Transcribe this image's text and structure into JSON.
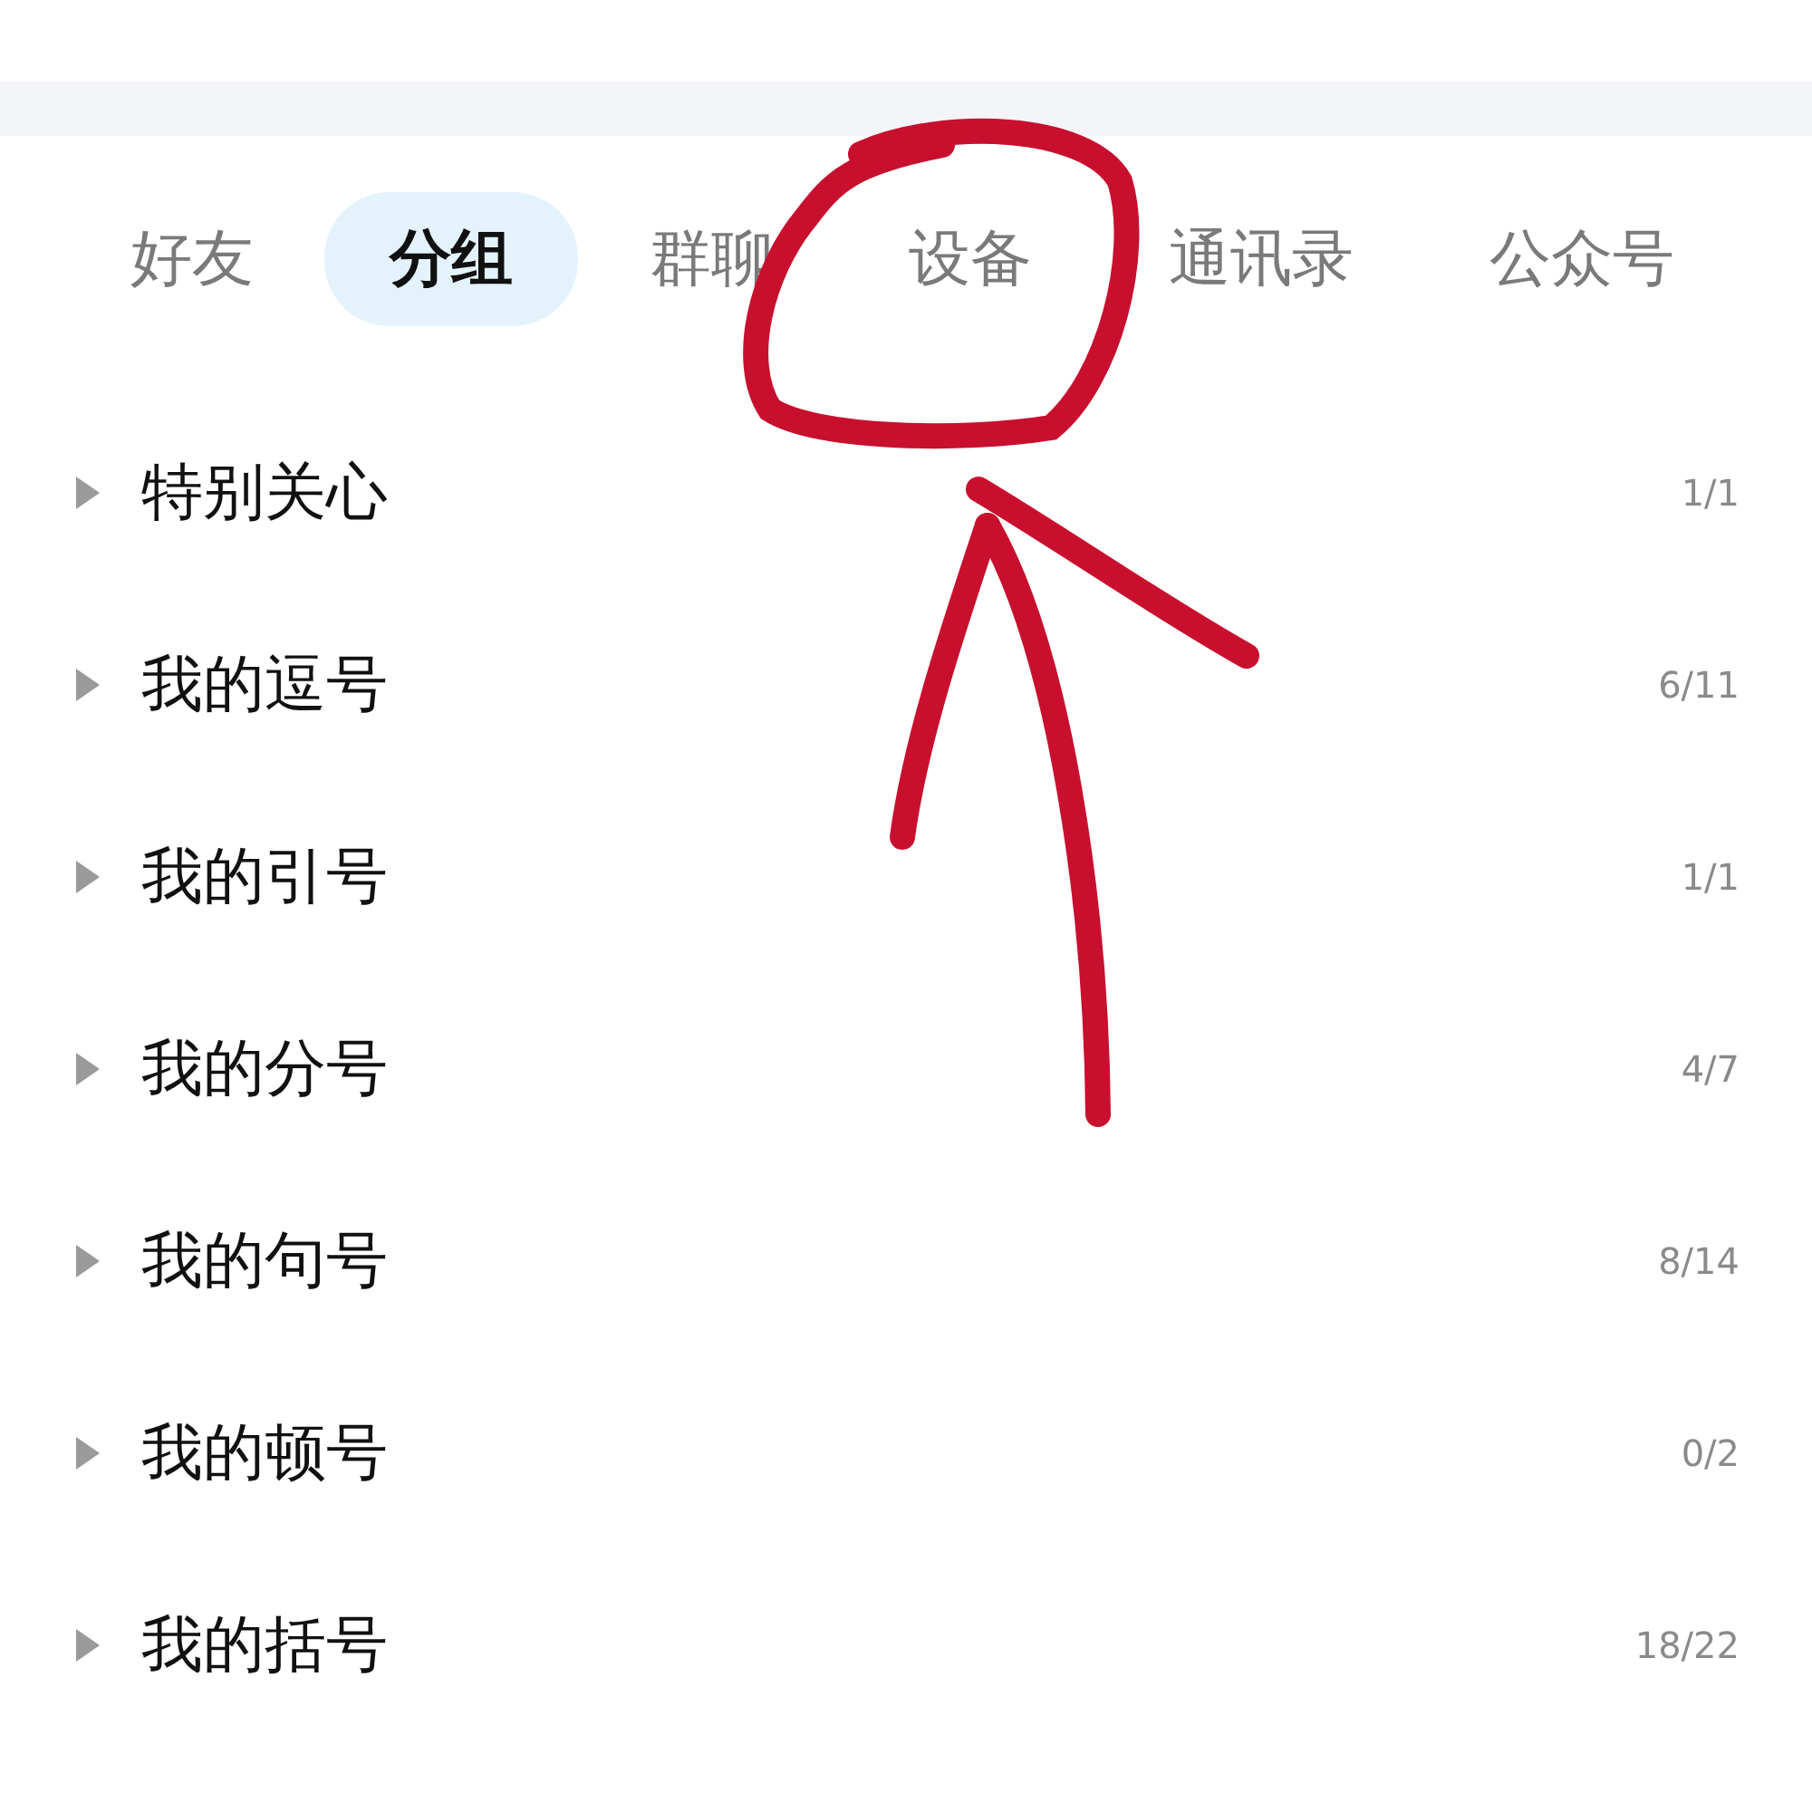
{
  "tabs": [
    {
      "label": "好友",
      "selected": false
    },
    {
      "label": "分组",
      "selected": true
    },
    {
      "label": "群聊",
      "selected": false
    },
    {
      "label": "设备",
      "selected": false
    },
    {
      "label": "通讯录",
      "selected": false
    },
    {
      "label": "公众号",
      "selected": false
    }
  ],
  "groups": [
    {
      "name": "特别关心",
      "count": "1/1",
      "expanded": false
    },
    {
      "name": "我的逗号",
      "count": "6/11",
      "expanded": false
    },
    {
      "name": "我的引号",
      "count": "1/1",
      "expanded": false
    },
    {
      "name": "我的分号",
      "count": "4/7",
      "expanded": false
    },
    {
      "name": "我的句号",
      "count": "8/14",
      "expanded": false
    },
    {
      "name": "我的顿号",
      "count": "0/2",
      "expanded": false
    },
    {
      "name": "我的括号",
      "count": "18/22",
      "expanded": false
    }
  ],
  "annotation": {
    "color": "#c8102e"
  }
}
